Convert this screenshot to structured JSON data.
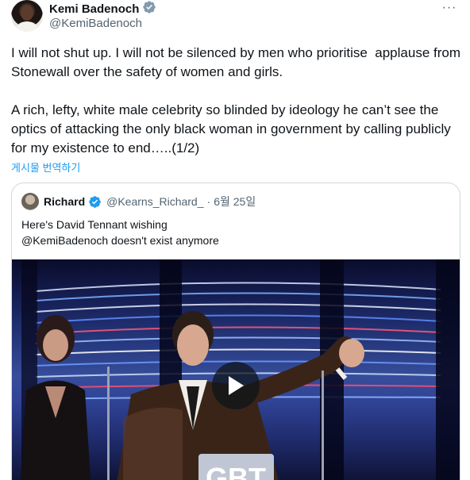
{
  "author": {
    "display_name": "Kemi Badenoch",
    "handle": "@KemiBadenoch",
    "verified_icon": "verified-badge-gray"
  },
  "more_icon": "more-horizontal-icon",
  "more_glyph": "···",
  "tweet": {
    "text": "I will not shut up. I will not be silenced by men who prioritise  applause from Stonewall over the safety of women and girls.\n\nA rich, lefty, white male celebrity so blinded by ideology he can’t see the optics of attacking the only black woman in government by calling publicly for my existence to end…..(1/2)",
    "translate_label": "게시물 번역하기"
  },
  "quote": {
    "display_name": "Richard",
    "handle": "@Kearns_Richard_",
    "separator": "·",
    "date": "6월 25일",
    "verified_icon": "verified-badge-blue",
    "text": "Here's David Tennant wishing\n@KemiBadenoch doesn't exist anymore",
    "media": {
      "type": "video",
      "play_icon": "play-icon",
      "overlay_text": "GBT"
    }
  },
  "colors": {
    "link": "#1d9bf0",
    "secondary_text": "#536471",
    "verified_gray": "#829aab",
    "verified_blue": "#1d9bf0",
    "border": "#cfd9de"
  }
}
